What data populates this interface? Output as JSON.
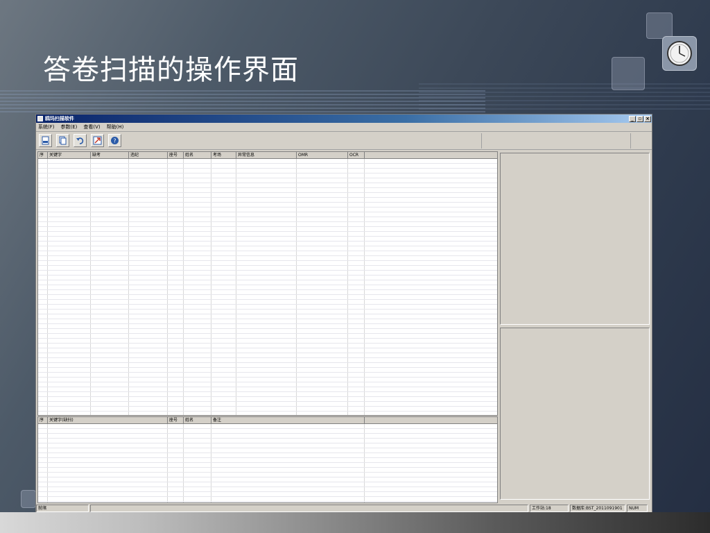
{
  "slide": {
    "title": "答卷扫描的操作界面"
  },
  "window": {
    "title": "鸥玛扫描软件",
    "controls": {
      "minimize": "_",
      "restore": "▫",
      "close": "×"
    }
  },
  "menu": [
    "系统(F)",
    "参数(E)",
    "查看(V)",
    "帮助(H)"
  ],
  "toolbar": {
    "buttons": [
      {
        "name": "scan-button",
        "icon": "scanner-icon"
      },
      {
        "name": "copy-button",
        "icon": "document-icon"
      },
      {
        "name": "undo-button",
        "icon": "undo-icon"
      },
      {
        "name": "export-button",
        "icon": "export-icon"
      },
      {
        "name": "help-button",
        "icon": "help-icon"
      }
    ]
  },
  "upper_grid": {
    "columns": [
      "序",
      "关键字",
      "缺考",
      "违纪",
      "座号",
      "姓名",
      "考场",
      "异常信息",
      "OMR",
      "OCR",
      ""
    ]
  },
  "lower_grid": {
    "columns": [
      "序",
      "关键字(缺扫)",
      "座号",
      "姓名",
      "备注",
      ""
    ]
  },
  "statusbar": {
    "ready": "就绪",
    "workstation": "工作站:18",
    "database": "数据库:BST_2011091901",
    "num": "NUM"
  },
  "colors": {
    "titlebar": "#0a246a",
    "window_face": "#d4d0c8",
    "grid_line": "#e6e6ec"
  }
}
